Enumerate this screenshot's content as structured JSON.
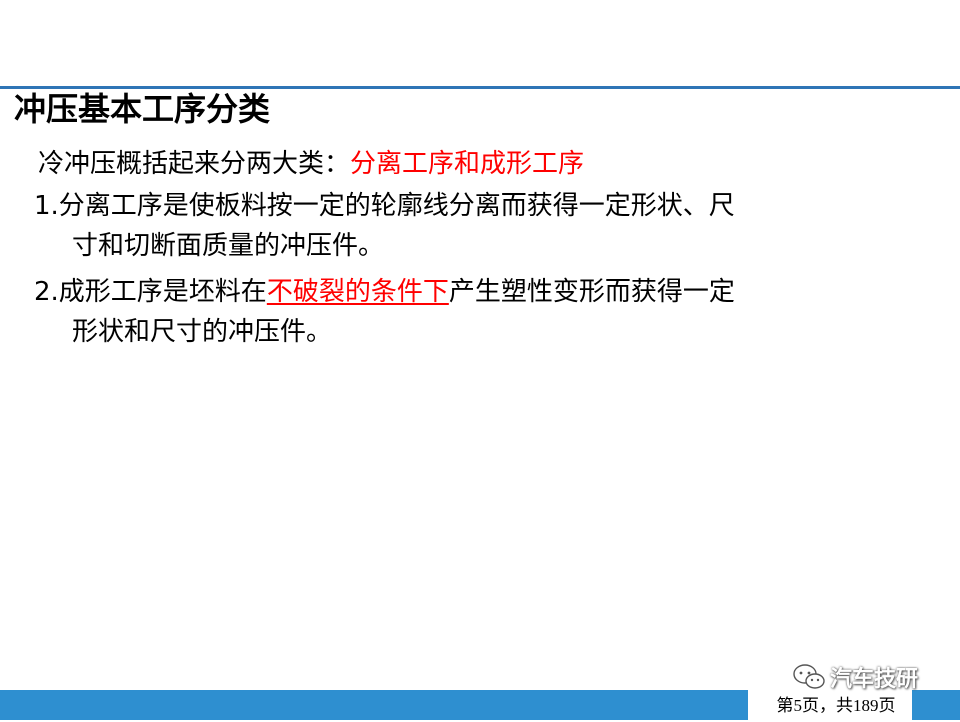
{
  "slide": {
    "title": "冲压基本工序分类",
    "intro_prefix": "冷冲压概括起来分两大类：",
    "intro_highlight": "分离工序和成形工序",
    "item1_line1": "1.分离工序是使板料按一定的轮廓线分离而获得一定形状、尺",
    "item1_line2": "寸和切断面质量的冲压件。",
    "item2_prefix": "2.成形工序是坯料在",
    "item2_highlight": "不破裂的条件下",
    "item2_suffix": "产生塑性变形而获得一定",
    "item2_line2": "形状和尺寸的冲压件。"
  },
  "footer": {
    "page_indicator": "第5页，共189页"
  },
  "watermark": {
    "text": "汽车技研",
    "icon": "wechat-icon"
  },
  "colors": {
    "accent_rule": "#2e75b6",
    "footer_bar": "#2e8fd0",
    "highlight": "#ff0000"
  }
}
